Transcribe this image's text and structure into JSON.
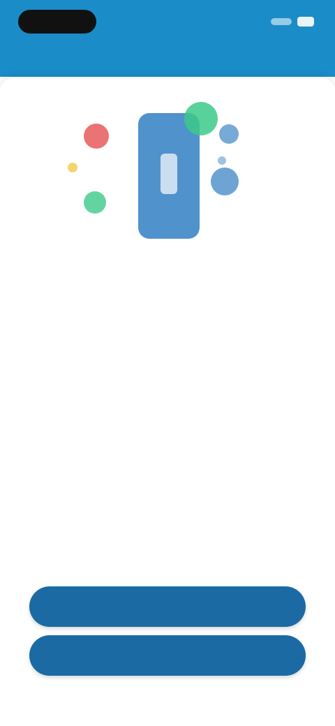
{
  "status_bar": {
    "left": "",
    "right": ""
  },
  "illustration": {
    "icon": "phone-apps-illustration-icon",
    "colors": {
      "phone": "#3d86c6",
      "red": "#e85a5a",
      "green": "#3cc98a",
      "blue": "#3d86c6",
      "yellow": "#f0c94a"
    }
  },
  "content": {
    "link_title": "",
    "lines": [
      "",
      "",
      "",
      "",
      "",
      ""
    ],
    "footnote": ""
  },
  "buttons": {
    "primary": "",
    "secondary": ""
  },
  "colors": {
    "header": "#1a8cc8",
    "button": "#1b6aa3"
  }
}
